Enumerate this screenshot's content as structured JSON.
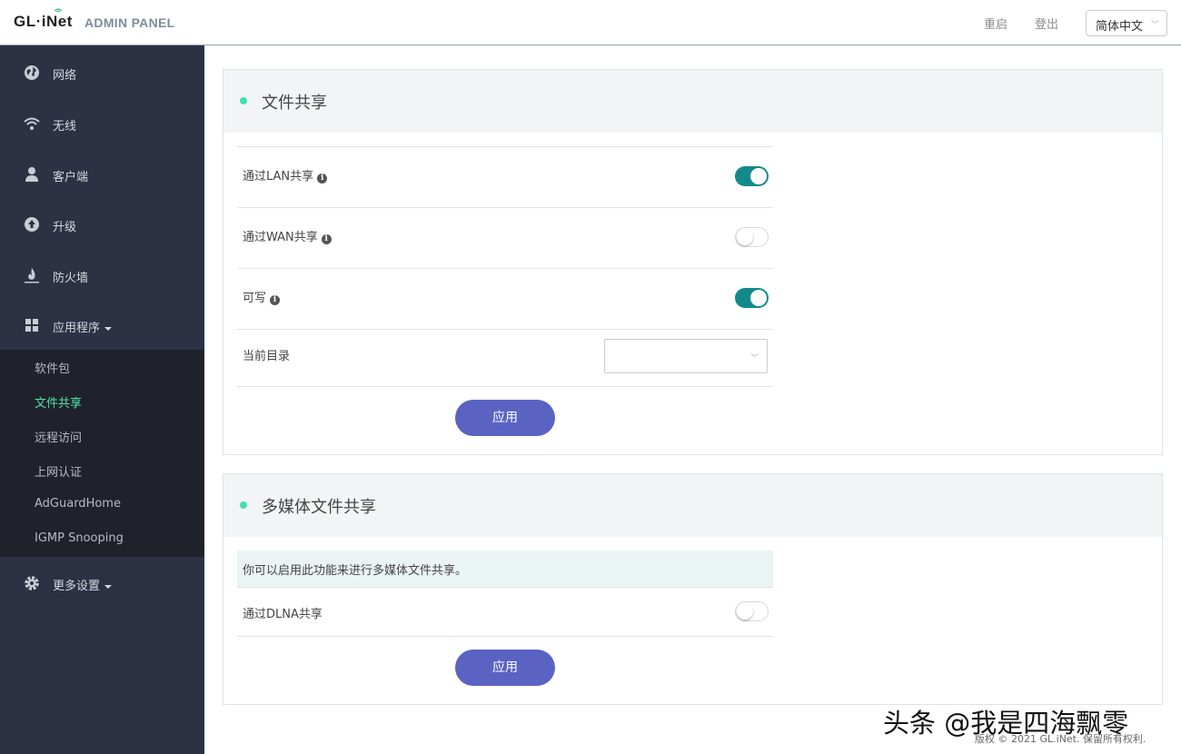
{
  "header": {
    "logo": "GL·iNet",
    "subtitle": "ADMIN PANEL",
    "reboot": "重启",
    "logout": "登出",
    "language": "简体中文"
  },
  "sidebar": {
    "items": [
      {
        "label": "网络",
        "icon": "globe-icon"
      },
      {
        "label": "无线",
        "icon": "wifi-icon"
      },
      {
        "label": "客户端",
        "icon": "user-icon"
      },
      {
        "label": "升级",
        "icon": "upload-icon"
      },
      {
        "label": "防火墙",
        "icon": "flame-icon"
      },
      {
        "label": "应用程序",
        "icon": "grid-icon"
      },
      {
        "label": "更多设置",
        "icon": "gear-icon"
      }
    ],
    "submenu": [
      "软件包",
      "文件共享",
      "远程访问",
      "上网认证",
      "AdGuardHome",
      "IGMP Snooping"
    ],
    "active_submenu": "文件共享"
  },
  "file_share": {
    "title": "文件共享",
    "lan_label": "通过LAN共享",
    "lan_on": true,
    "wan_label": "通过WAN共享",
    "wan_on": false,
    "writable_label": "可写",
    "writable_on": true,
    "dir_label": "当前目录",
    "dir_value": "",
    "apply": "应用"
  },
  "media_share": {
    "title": "多媒体文件共享",
    "notice": "你可以启用此功能来进行多媒体文件共享。",
    "dlna_label": "通过DLNA共享",
    "dlna_on": false,
    "apply": "应用"
  },
  "watermark": "头条 @我是四海飘零",
  "footer": "版权 © 2021 GL.iNet. 保留所有权利.",
  "colors": {
    "sidebar_bg": "#2c3143",
    "submenu_bg": "#1f222b",
    "active_green": "#4fe3a8",
    "toggle_on": "#128a8c",
    "button": "#5b63c2"
  }
}
